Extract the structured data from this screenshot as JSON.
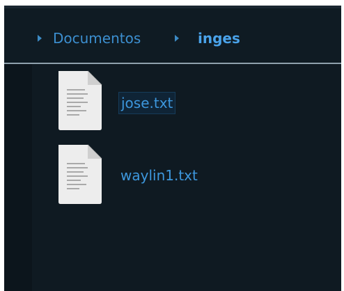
{
  "breadcrumb": {
    "items": [
      {
        "label": "Documentos"
      },
      {
        "label": "inges"
      }
    ]
  },
  "files": [
    {
      "name": "jose.txt",
      "icon": "text-file-icon",
      "selected": true
    },
    {
      "name": "waylin1.txt",
      "icon": "text-file-icon",
      "selected": false
    }
  ],
  "colors": {
    "background": "#0f1a22",
    "accent": "#3c8fd0",
    "active_crumb": "#4aa3ea"
  }
}
